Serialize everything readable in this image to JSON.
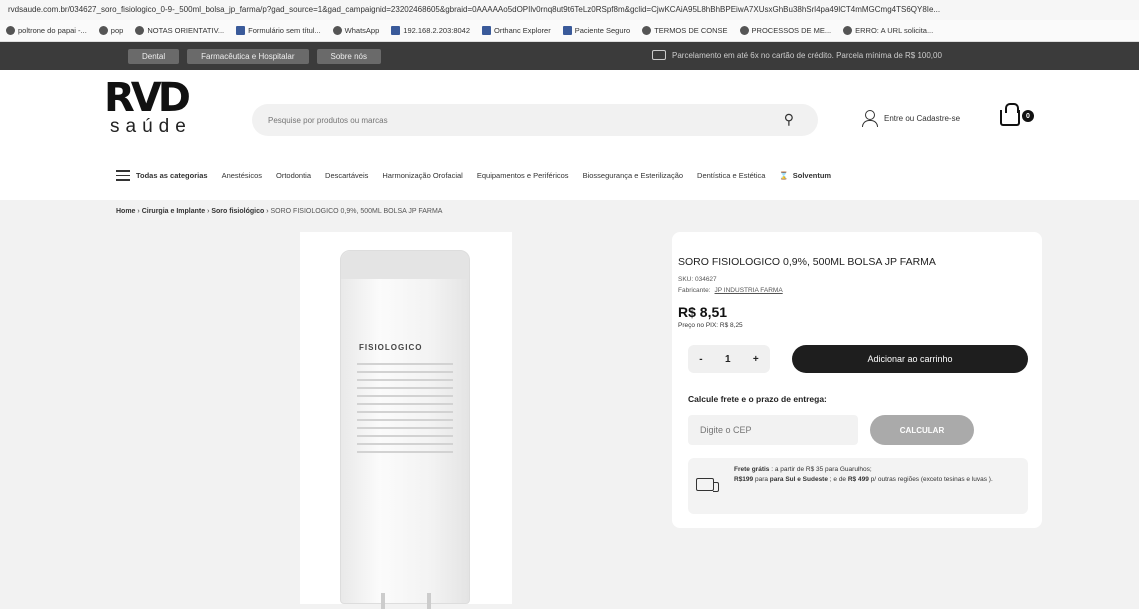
{
  "browser": {
    "url": "rvdsaude.com.br/034627_soro_fisiologico_0-9-_500ml_bolsa_jp_farma/p?gad_source=1&gad_campaignid=23202468605&gbraid=0AAAAAo5dOPIlv0rnq8ut9t6TeLz0RSpf8m&gclid=CjwKCAiA95L8hBhBPEiwA7XUsxGhBu38hSrl4pa49lCT4mMGCmg4TS6QY8Ie...",
    "bookmarks": [
      {
        "label": "poltrone do papai -...",
        "icon": "bookmark-icon"
      },
      {
        "label": "pop",
        "icon": "globe-icon"
      },
      {
        "label": "NOTAS ORIENTATIV...",
        "icon": "globe-icon"
      },
      {
        "label": "Formulário sem títul...",
        "icon": "form-icon"
      },
      {
        "label": "WhatsApp",
        "icon": "whatsapp-icon"
      },
      {
        "label": "192.168.2.203:8042",
        "icon": "server-icon"
      },
      {
        "label": "Orthanc Explorer",
        "icon": "server-icon"
      },
      {
        "label": "Paciente Seguro",
        "icon": "form-icon"
      },
      {
        "label": "TERMOS DE CONSE",
        "icon": "globe-icon"
      },
      {
        "label": "PROCESSOS DE ME...",
        "icon": "globe-icon"
      },
      {
        "label": "ERRO: A URL solicita...",
        "icon": "globe-icon"
      }
    ]
  },
  "topbar": {
    "tabs": [
      "Dental",
      "Farmacêutica e Hospitalar",
      "Sobre nós"
    ],
    "notice": "Parcelamento em até 6x no cartão de crédito. Parcela mínima de R$ 100,00"
  },
  "header": {
    "logo_mark": "RVD",
    "logo_sub": "saúde",
    "search_placeholder": "Pesquise por produtos ou marcas",
    "login_label": "Entre ou Cadastre-se",
    "cart_count": "0"
  },
  "categories": {
    "all_label": "Todas as categorias",
    "items": [
      "Anestésicos",
      "Ortodontia",
      "Descartáveis",
      "Harmonização Orofacial",
      "Equipamentos e Periféricos",
      "Biossegurança e Esterilização",
      "Dentística e Estética"
    ],
    "brand_label": "Solventum"
  },
  "breadcrumb": {
    "home": "Home",
    "level1": "Cirurgia e Implante",
    "level2": "Soro fisiológico",
    "current": "SORO FISIOLOGICO 0,9%, 500ML BOLSA JP FARMA",
    "separator": "›"
  },
  "product": {
    "image_label": "FISIOLOGICO",
    "title": "SORO FISIOLOGICO 0,9%, 500ML BOLSA JP FARMA",
    "sku": "SKU: 034627",
    "maker_label": "Fabricante:",
    "maker": "JP INDUSTRIA FARMA",
    "price": "R$ 8,51",
    "pix_price": "Preço no PIX: R$ 8,25",
    "qty_minus": "-",
    "qty_value": "1",
    "qty_plus": "+",
    "add_to_cart": "Adicionar ao carrinho"
  },
  "shipping": {
    "label": "Calcule frete e o prazo de entrega:",
    "cep_placeholder": "Digite o CEP",
    "calc_button": "CALCULAR",
    "free_title": "Frete grátis",
    "free_line1": ": a partir de R$ 35 para Guarulhos;",
    "free_amount2": "R$199",
    "free_region2": "para Sul e Sudeste",
    "free_amount3": "R$ 499",
    "free_tail": "p/ outras regiões (exceto tesinas e luvas )."
  }
}
